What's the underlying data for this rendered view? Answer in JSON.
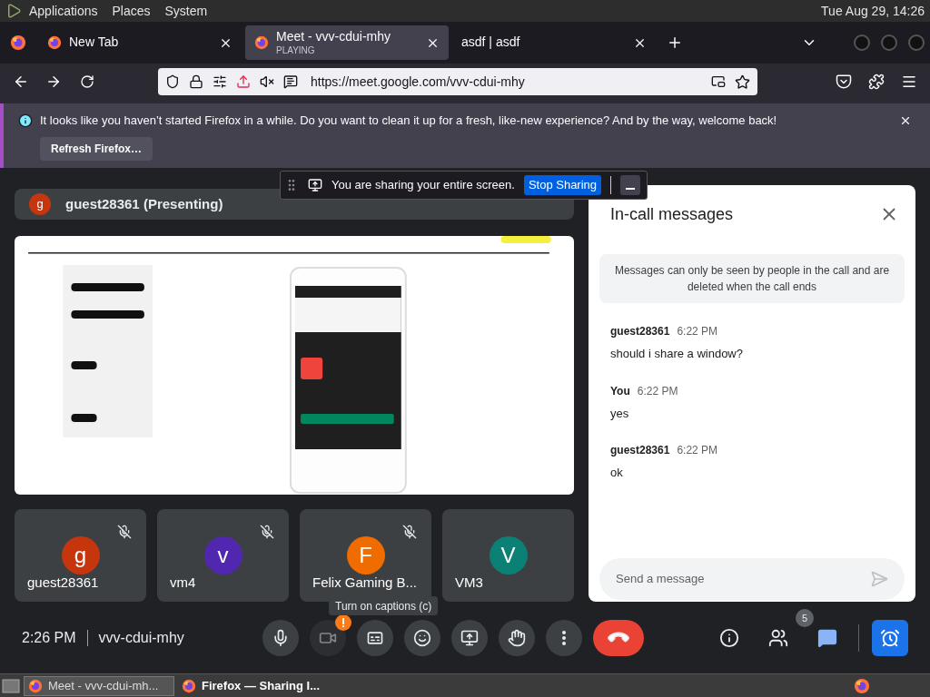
{
  "top_panel": {
    "menus": [
      "Applications",
      "Places",
      "System"
    ],
    "clock": "Tue Aug 29, 14:26"
  },
  "tabs": [
    {
      "title": "New Tab",
      "selected": false
    },
    {
      "title": "Meet - vvv-cdui-mhy",
      "subtitle": "PLAYING",
      "selected": true
    },
    {
      "title": "asdf | asdf",
      "selected": false
    }
  ],
  "url": "https://meet.google.com/vvv-cdui-mhy",
  "notification": {
    "text": "It looks like you haven’t started Firefox in a while. Do you want to clean it up for a fresh, like-new experience? And by the way, welcome back!",
    "button": "Refresh Firefox…"
  },
  "sharing_bar": {
    "text": "You are sharing your entire screen.",
    "button": "Stop Sharing"
  },
  "presenter": {
    "initial": "g",
    "name": "guest28361 (Presenting)"
  },
  "participants": [
    {
      "name": "guest28361",
      "initial": "g",
      "color": "#c5360f",
      "muted": true
    },
    {
      "name": "vm4",
      "initial": "v",
      "color": "#5127b0",
      "muted": true
    },
    {
      "name": "Felix Gaming B...",
      "initial": "F",
      "color": "#ef6c00",
      "muted": true
    },
    {
      "name": "VM3",
      "initial": "V",
      "color": "#0b8074",
      "muted": false
    }
  ],
  "chat": {
    "title": "In-call messages",
    "notice": "Messages can only be seen by people in the call and are deleted when the call ends",
    "messages": [
      {
        "sender": "guest28361",
        "time": "6:22 PM",
        "text": "should i share a window?"
      },
      {
        "sender": "You",
        "time": "6:22 PM",
        "text": "yes"
      },
      {
        "sender": "guest28361",
        "time": "6:22 PM",
        "text": "ok"
      }
    ],
    "input": {
      "placeholder": "Send a message"
    }
  },
  "tooltip": "Turn on captions (c)",
  "meeting": {
    "time": "2:26 PM",
    "code": "vvv-cdui-mhy"
  },
  "controls": [
    {
      "kind": "mic"
    },
    {
      "kind": "camera",
      "warning": true
    },
    {
      "kind": "captions"
    },
    {
      "kind": "emoji"
    },
    {
      "kind": "present"
    },
    {
      "kind": "hand"
    },
    {
      "kind": "more"
    },
    {
      "kind": "hangup"
    }
  ],
  "side_controls": [
    {
      "kind": "info",
      "selected": false
    },
    {
      "kind": "people",
      "badge": "5",
      "selected": false
    },
    {
      "kind": "chat",
      "selected": true
    },
    {
      "kind": "activities",
      "selected": false
    }
  ],
  "taskbar": [
    {
      "title": "Meet - vvv-cdui-mh...",
      "selected": false
    },
    {
      "title": "Firefox — Sharing I...",
      "selected": true
    }
  ]
}
